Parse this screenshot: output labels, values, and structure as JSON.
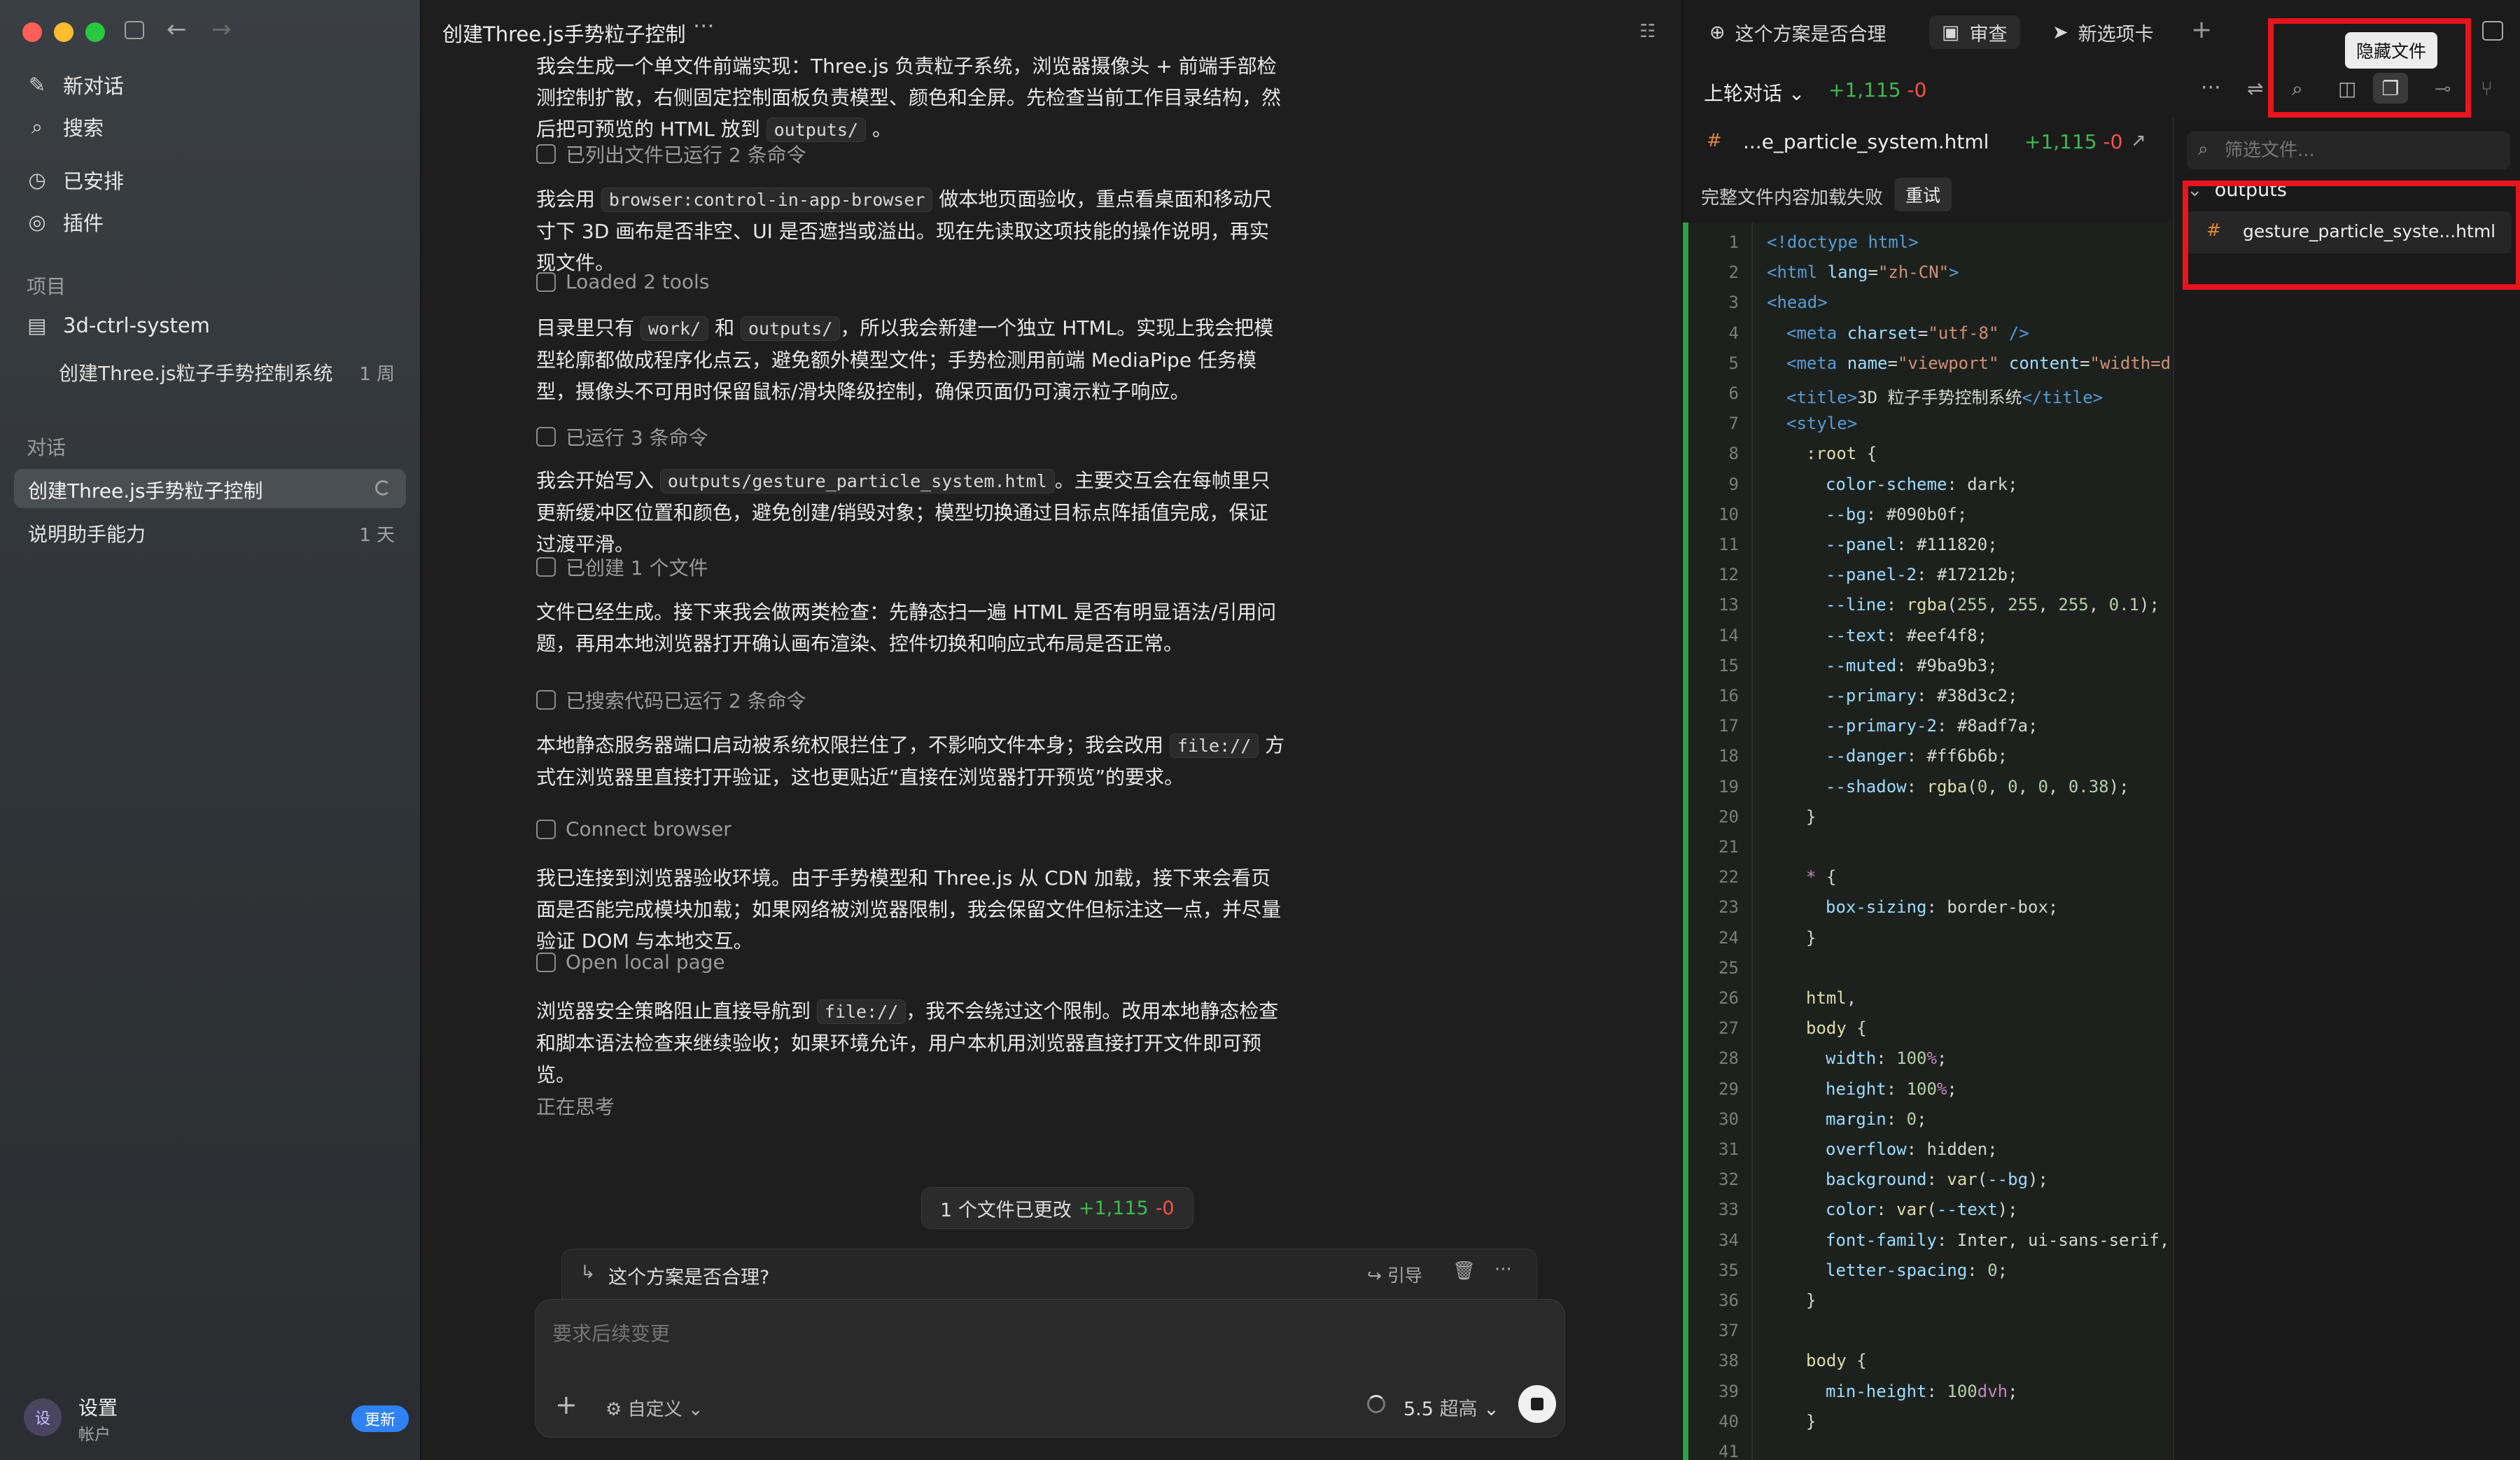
{
  "sidebar": {
    "nav": [
      {
        "label": "新对话"
      },
      {
        "label": "搜索"
      },
      {
        "label": "已安排"
      },
      {
        "label": "插件"
      }
    ],
    "projects_header": "项目",
    "project_name": "3d-ctrl-system",
    "project_thread": "创建Three.js粒子手势控制系统",
    "project_thread_age": "1 周",
    "threads_header": "对话",
    "threads": [
      {
        "label": "创建Three.js手势粒子控制",
        "age": ""
      },
      {
        "label": "说明助手能力",
        "age": "1 天"
      }
    ],
    "settings_label": "设置",
    "account_label": "帐户",
    "avatar_text": "设",
    "update_badge": "更新"
  },
  "middle": {
    "title": "创建Three.js手势粒子控制",
    "more": "···",
    "messages": [
      {
        "type": "text",
        "parts": [
          "我会生成一个单文件前端实现：Three.js 负责粒子系统，浏览器摄像头 + 前端手部检测控制扩散，右侧固定控制面板负责模型、颜色和全屏。先检查当前工作目录结构，然后把可预览的 HTML 放到 ",
          "outputs/",
          " 。"
        ]
      },
      {
        "type": "status",
        "label": "已列出文件已运行 2 条命令"
      },
      {
        "type": "text",
        "parts": [
          "我会用 ",
          "browser:control-in-app-browser",
          " 做本地页面验收，重点看桌面和移动尺寸下 3D 画布是否非空、UI 是否遮挡或溢出。现在先读取这项技能的操作说明，再实现文件。"
        ]
      },
      {
        "type": "status",
        "label": "Loaded 2 tools"
      },
      {
        "type": "text",
        "parts": [
          "目录里只有 ",
          "work/",
          " 和 ",
          "outputs/",
          "，所以我会新建一个独立 HTML。实现上我会把模型轮廓都做成程序化点云，避免额外模型文件；手势检测用前端 MediaPipe 任务模型，摄像头不可用时保留鼠标/滑块降级控制，确保页面仍可演示粒子响应。"
        ]
      },
      {
        "type": "status",
        "label": "已运行 3 条命令"
      },
      {
        "type": "text",
        "parts": [
          "我会开始写入 ",
          "outputs/gesture_particle_system.html",
          "。主要交互会在每帧里只更新缓冲区位置和颜色，避免创建/销毁对象；模型切换通过目标点阵插值完成，保证过渡平滑。"
        ]
      },
      {
        "type": "status",
        "label": "已创建 1 个文件"
      },
      {
        "type": "text",
        "parts": [
          "文件已经生成。接下来我会做两类检查：先静态扫一遍 HTML 是否有明显语法/引用问题，再用本地浏览器打开确认画布渲染、控件切换和响应式布局是否正常。"
        ]
      },
      {
        "type": "status",
        "label": "已搜索代码已运行 2 条命令"
      },
      {
        "type": "text",
        "parts": [
          "本地静态服务器端口启动被系统权限拦住了，不影响文件本身；我会改用 ",
          "file://",
          " 方式在浏览器里直接打开验证，这也更贴近“直接在浏览器打开预览”的要求。"
        ]
      },
      {
        "type": "status",
        "label": "Connect browser"
      },
      {
        "type": "text",
        "parts": [
          "我已连接到浏览器验收环境。由于手势模型和 Three.js 从 CDN 加载，接下来会看页面是否能完成模块加载；如果网络被浏览器限制，我会保留文件但标注这一点，并尽量验证 DOM 与本地交互。"
        ]
      },
      {
        "type": "status",
        "label": "Open local page"
      },
      {
        "type": "text",
        "parts": [
          "浏览器安全策略阻止直接导航到 ",
          "file://",
          "，我不会绕过这个限制。改用本地静态检查和脚本语法检查来继续验收；如果环境允许，用户本机用浏览器直接打开文件即可预览。"
        ]
      },
      {
        "type": "thinking",
        "label": "正在思考"
      }
    ],
    "changes_pill": {
      "label": "1 个文件已更改",
      "added": "+1,115",
      "removed": "-0"
    },
    "queued": {
      "text": "这个方案是否合理?",
      "guide": "引导"
    },
    "composer": {
      "placeholder": "要求后续变更",
      "mode": "自定义",
      "model": "5.5",
      "effort": "超高"
    }
  },
  "right": {
    "tabs": [
      {
        "label": "这个方案是否合理"
      },
      {
        "label": "审查"
      },
      {
        "label": "新选项卡"
      }
    ],
    "tooltip": "隐藏文件",
    "scope": "上轮对话",
    "scope_added": "+1,115",
    "scope_removed": "-0",
    "file_title": "...e_particle_system.html",
    "file_added": "+1,115",
    "file_removed": "-0",
    "load_error": "完整文件内容加载失败",
    "retry": "重试",
    "filter_placeholder": "筛选文件...",
    "folder": "outputs",
    "file_entry": "gesture_particle_syste...html",
    "colors": {
      "annotation": "#e8141e",
      "added": "#3fb950",
      "removed": "#f85149",
      "accent": "#2f81f7"
    }
  }
}
